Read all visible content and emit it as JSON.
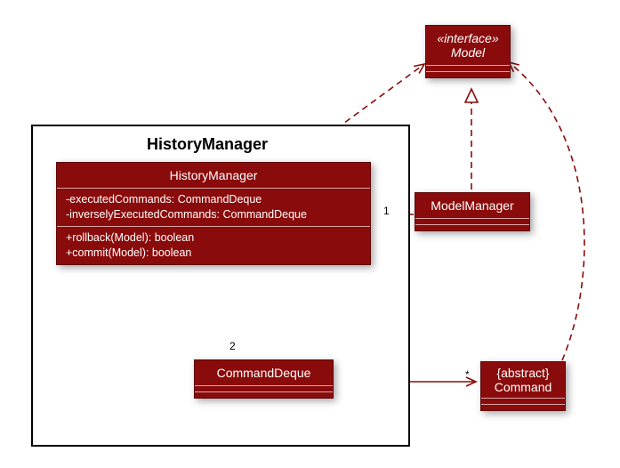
{
  "package": {
    "label": "HistoryManager"
  },
  "interface": {
    "stereotype": "«interface»",
    "name": "Model"
  },
  "historyManager": {
    "name": "HistoryManager",
    "attrs": [
      "-executedCommands: CommandDeque",
      "-inverselyExecutedCommands: CommandDeque"
    ],
    "ops": [
      "+rollback(Model): boolean",
      "+commit(Model): boolean"
    ]
  },
  "modelManager": {
    "name": "ModelManager"
  },
  "commandDeque": {
    "name": "CommandDeque"
  },
  "command": {
    "curly": "{abstract}",
    "name": "Command"
  },
  "relationships": {
    "hm_to_cd_mult": "2",
    "cd_to_cmd_mult": "*",
    "mm_to_hm_mult": "1"
  },
  "colors": {
    "class_fill": "#8a0b0b",
    "line": "#8a0b0b"
  },
  "chart_data": {
    "type": "uml-class-diagram",
    "package": "HistoryManager",
    "classes": [
      {
        "name": "Model",
        "stereotype": "interface"
      },
      {
        "name": "HistoryManager",
        "attributes": [
          "-executedCommands: CommandDeque",
          "-inverselyExecutedCommands: CommandDeque"
        ],
        "operations": [
          "+rollback(Model): boolean",
          "+commit(Model): boolean"
        ],
        "in_package": "HistoryManager"
      },
      {
        "name": "ModelManager"
      },
      {
        "name": "CommandDeque",
        "in_package": "HistoryManager"
      },
      {
        "name": "Command",
        "modifier": "abstract"
      }
    ],
    "relationships": [
      {
        "from": "ModelManager",
        "to": "Model",
        "type": "realization"
      },
      {
        "from": "ModelManager",
        "to": "HistoryManager",
        "type": "dependency",
        "multiplicity_to": "1"
      },
      {
        "from": "HistoryManager",
        "to": "CommandDeque",
        "type": "dependency",
        "multiplicity_to": "2"
      },
      {
        "from": "HistoryManager",
        "to": "Model",
        "type": "dependency"
      },
      {
        "from": "CommandDeque",
        "to": "Command",
        "type": "aggregation",
        "multiplicity_to": "*"
      },
      {
        "from": "Command",
        "to": "Model",
        "type": "dependency"
      }
    ]
  }
}
